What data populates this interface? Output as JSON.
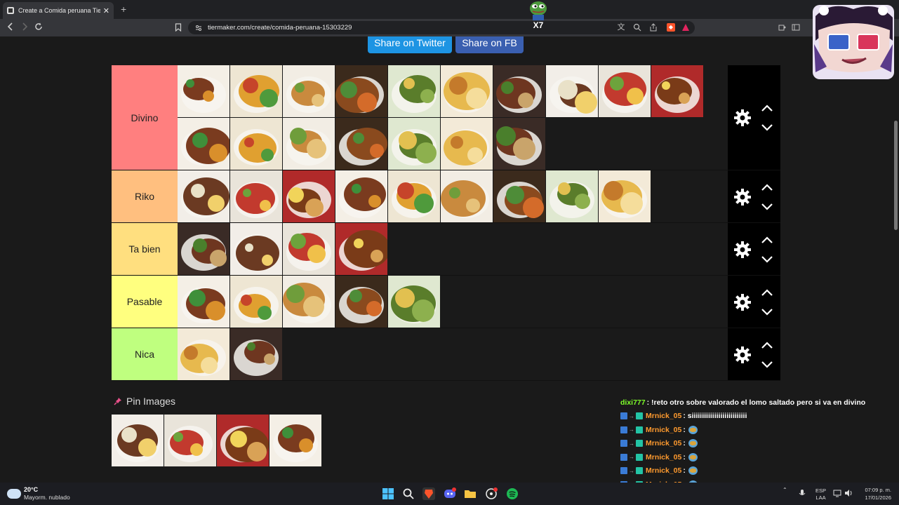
{
  "browser": {
    "tab_title": "Create a Comida peruana Tier Li",
    "new_tab": "+",
    "tab_close": "✕",
    "url": "tiermaker.com/create/comida-peruana-15303229"
  },
  "share": {
    "twitter": "Share on Twitter",
    "facebook": "Share on FB"
  },
  "tiers": [
    {
      "label": "Divino",
      "color": "#ff7f7f",
      "count": 17
    },
    {
      "label": "Riko",
      "color": "#ffbf7f",
      "count": 9
    },
    {
      "label": "Ta bien",
      "color": "#ffdf7f",
      "count": 4
    },
    {
      "label": "Pasable",
      "color": "#ffff7f",
      "count": 5
    },
    {
      "label": "Nica",
      "color": "#bfff7f",
      "count": 2
    }
  ],
  "pin": {
    "heading": "Pin Images",
    "count": 4
  },
  "chat": [
    {
      "user": "dixi777",
      "user_color": "#7fff2a",
      "message": ": !reto otro sobre valorado el lomo saltado pero si va en divino",
      "badges": false,
      "emote": false
    },
    {
      "user": "Mrnick_05",
      "user_color": "#ff9a2e",
      "message": ": siiiiiiiiiiiiiiiiiiiiiiiiiii",
      "badges": true,
      "emote": false
    },
    {
      "user": "Mrnick_05",
      "user_color": "#ff9a2e",
      "message": " :",
      "badges": true,
      "emote": true
    },
    {
      "user": "Mrnick_05",
      "user_color": "#ff9a2e",
      "message": " :",
      "badges": true,
      "emote": true
    },
    {
      "user": "Mrnick_05",
      "user_color": "#ff9a2e",
      "message": " :",
      "badges": true,
      "emote": true
    },
    {
      "user": "Mrnick_05",
      "user_color": "#ff9a2e",
      "message": " :",
      "badges": true,
      "emote": true
    },
    {
      "user": "Mrnick_05",
      "user_color": "#ff9a2e",
      "message": " :",
      "badges": true,
      "emote": true
    },
    {
      "user": "Mrnick_05",
      "user_color": "#ff9a2e",
      "message": " :",
      "badges": true,
      "emote": true
    }
  ],
  "taskbar": {
    "temp": "20°C",
    "weather": "Mayorm. nublado",
    "lang_1": "ESP",
    "lang_2": "LAA",
    "time": "07:09 p. m.",
    "date": "17/01/2026"
  },
  "overlay": {
    "pepe_text": "X7"
  },
  "colors": {
    "page_bg": "#1a1a1a",
    "control_bg": "#000000",
    "twitter_button": "#1d94e3",
    "facebook_button": "#3a5fb0"
  }
}
